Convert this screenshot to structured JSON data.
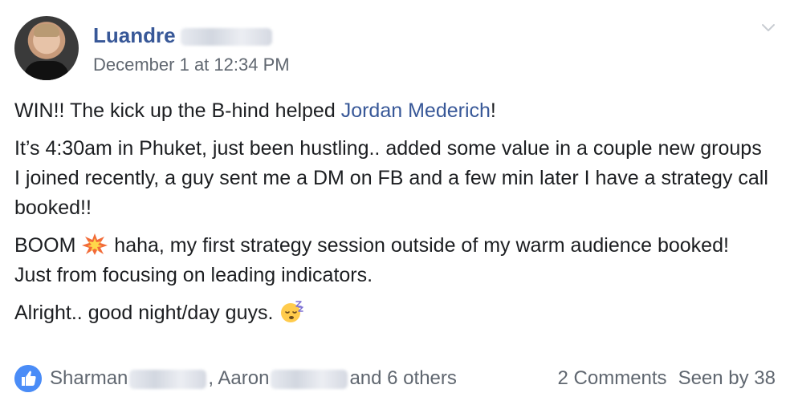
{
  "post": {
    "author": "Luandre",
    "timestamp": "December 1 at 12:34 PM",
    "line1_prefix": "WIN!! The kick up the B-hind helped ",
    "mention": "Jordan Mederich",
    "line1_suffix": "!",
    "paragraph2": "It’s 4:30am in Phuket, just been hustling.. added some value in a couple new groups I joined recently, a guy sent me a DM on FB and a few min later I have a strategy call booked!!",
    "paragraph3_prefix": "BOOM ",
    "paragraph3_suffix": " haha, my first strategy session outside of my warm audience booked! Just from focusing on leading indicators.",
    "paragraph4": "Alright.. good night/day guys. "
  },
  "footer": {
    "reactor1": "Sharman",
    "separator": ", Aaron",
    "others": "and 6 others",
    "comments": "2 Comments",
    "seen_by": "Seen by 38"
  },
  "colors": {
    "link": "#385898",
    "text": "#1c1e21",
    "muted": "#606770",
    "like": "#4a8cf7"
  },
  "icons": {
    "chevron": "chevron-down-icon",
    "like": "like-icon",
    "boom": "collision-emoji-icon",
    "sleep": "sleeping-face-emoji-icon"
  }
}
